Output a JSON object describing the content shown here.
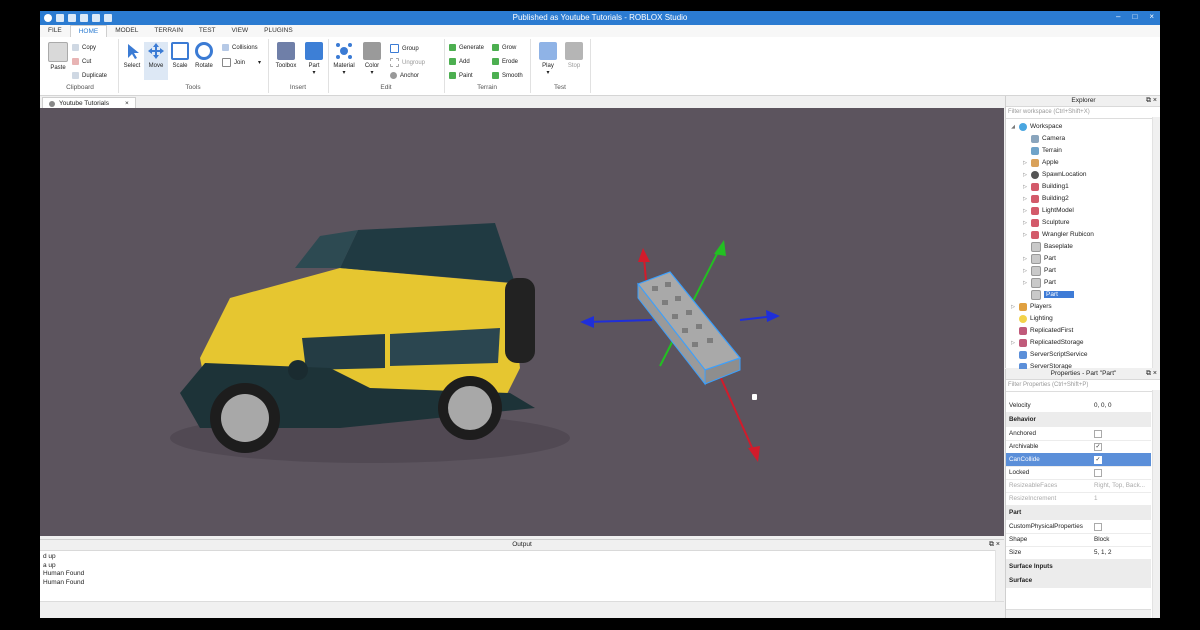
{
  "window": {
    "title": "Published as Youtube Tutorials - ROBLOX Studio"
  },
  "menu": {
    "tabs": [
      "FILE",
      "HOME",
      "MODEL",
      "TERRAIN",
      "TEST",
      "VIEW",
      "PLUGINS"
    ]
  },
  "ribbon": {
    "clipboard": {
      "paste": "Paste",
      "copy": "Copy",
      "cut": "Cut",
      "duplicate": "Duplicate",
      "label": "Clipboard"
    },
    "tools": {
      "select": "Select",
      "move": "Move",
      "scale": "Scale",
      "rotate": "Rotate",
      "collisions": "Collisions",
      "join": "Join",
      "label": "Tools"
    },
    "insert": {
      "toolbox": "Toolbox",
      "part": "Part",
      "label": "Insert"
    },
    "edit": {
      "material": "Material",
      "color": "Color",
      "group": "Group",
      "ungroup": "Ungroup",
      "anchor": "Anchor",
      "label": "Edit"
    },
    "terrain": {
      "generate": "Generate",
      "add": "Add",
      "paint": "Paint",
      "grow": "Grow",
      "erode": "Erode",
      "smooth": "Smooth",
      "label": "Terrain"
    },
    "test": {
      "play": "Play",
      "stop": "Stop",
      "label": "Test"
    }
  },
  "document_tab": {
    "label": "Youtube Tutorials"
  },
  "output": {
    "title": "Output",
    "lines": [
      "d up",
      "a up",
      "Human Found",
      "Human Found"
    ]
  },
  "explorer": {
    "title": "Explorer",
    "filter_placeholder": "Filter workspace (Ctrl+Shift+X)",
    "items": [
      {
        "label": "Workspace",
        "icon": "workspace-icon"
      },
      {
        "label": "Camera",
        "icon": "camera-icon"
      },
      {
        "label": "Terrain",
        "icon": "terrain-icon"
      },
      {
        "label": "Apple",
        "icon": "model-icon"
      },
      {
        "label": "SpawnLocation",
        "icon": "spawn-icon"
      },
      {
        "label": "Building1",
        "icon": "model-icon"
      },
      {
        "label": "Building2",
        "icon": "model-icon"
      },
      {
        "label": "LightModel",
        "icon": "model-icon"
      },
      {
        "label": "Sculpture",
        "icon": "model-icon"
      },
      {
        "label": "Wrangler Rubicon",
        "icon": "model-icon"
      },
      {
        "label": "Baseplate",
        "icon": "part-icon"
      },
      {
        "label": "Part",
        "icon": "part-icon"
      },
      {
        "label": "Part",
        "icon": "part-icon"
      },
      {
        "label": "Part",
        "icon": "part-icon"
      },
      {
        "label": "Part",
        "icon": "part-icon",
        "selected": true
      },
      {
        "label": "Players",
        "icon": "players-icon"
      },
      {
        "label": "Lighting",
        "icon": "lighting-icon"
      },
      {
        "label": "ReplicatedFirst",
        "icon": "replicated-icon"
      },
      {
        "label": "ReplicatedStorage",
        "icon": "replicated-icon"
      },
      {
        "label": "ServerScriptService",
        "icon": "service-icon"
      },
      {
        "label": "ServerStorage",
        "icon": "service-icon"
      }
    ]
  },
  "properties": {
    "title": "Properties - Part \"Part\"",
    "filter_placeholder": "Filter Properties (Ctrl+Shift+P)",
    "rows": [
      {
        "name": "Velocity",
        "value": "0, 0, 0"
      },
      {
        "category": "Behavior"
      },
      {
        "name": "Anchored",
        "checkbox": false
      },
      {
        "name": "Archivable",
        "checkbox": true
      },
      {
        "name": "CanCollide",
        "checkbox": true,
        "selected": true
      },
      {
        "name": "Locked",
        "checkbox": false
      },
      {
        "name": "ResizeableFaces",
        "value": "Right, Top, Back...",
        "dim": true
      },
      {
        "name": "ResizeIncrement",
        "value": "1",
        "dim": true
      },
      {
        "category": "Part"
      },
      {
        "name": "CustomPhysicalProperties",
        "checkbox": false
      },
      {
        "name": "Shape",
        "value": "Block"
      },
      {
        "name": "Size",
        "value": "5, 1, 2"
      },
      {
        "category": "Surface Inputs"
      },
      {
        "category": "Surface"
      }
    ]
  },
  "colors": {
    "accent": "#2b7bd1",
    "viewport": "#5c545e",
    "selection": "#3e7bd6"
  }
}
